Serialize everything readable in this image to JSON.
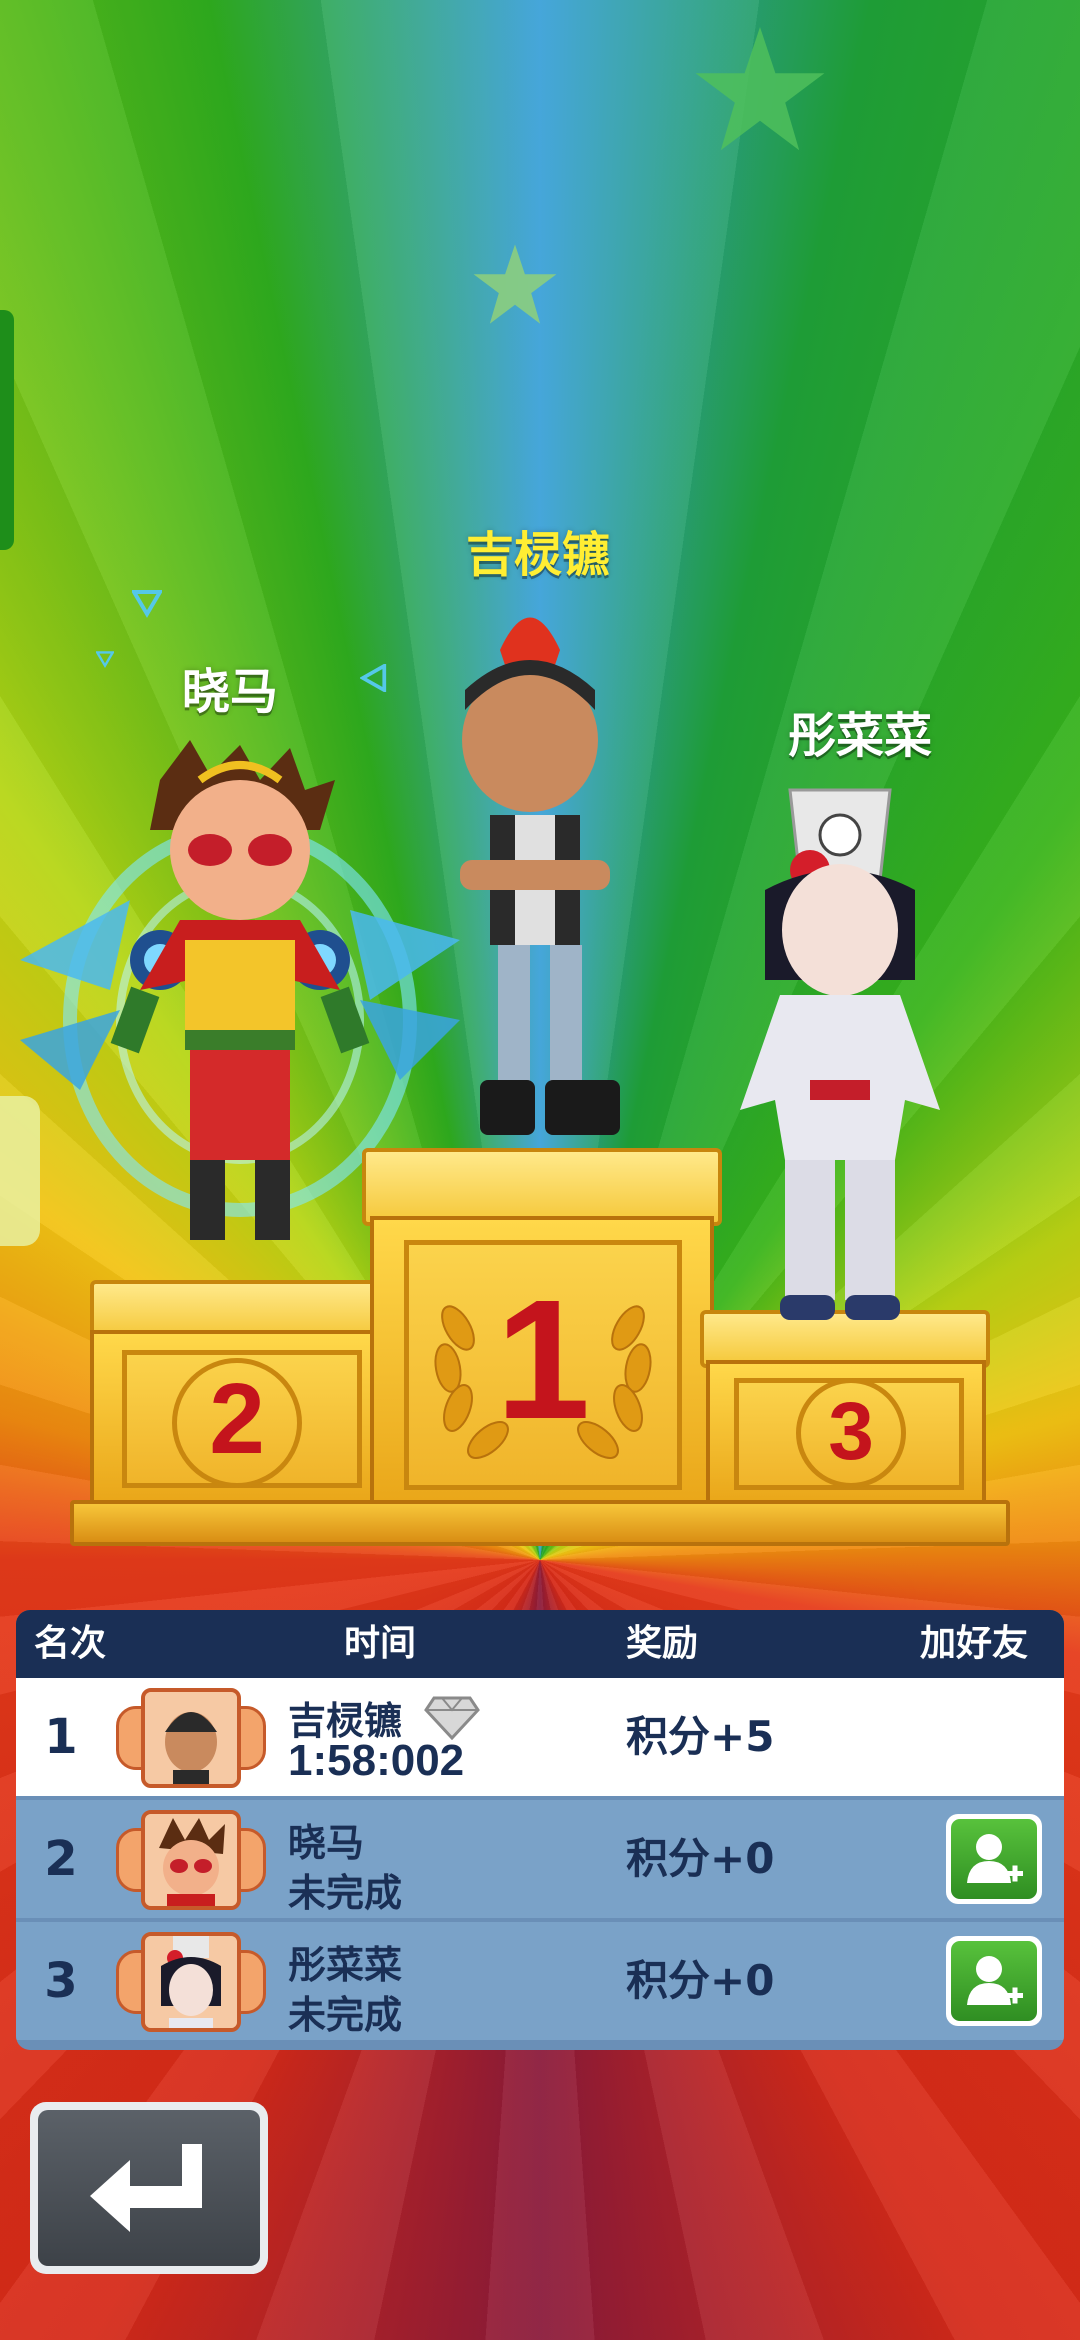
{
  "podium": {
    "first_name": "吉棂镳",
    "second_name": "晓马",
    "third_name": "彤菜菜",
    "first_num": "1",
    "second_num": "2",
    "third_num": "3"
  },
  "table": {
    "headers": {
      "rank": "名次",
      "time": "时间",
      "reward": "奖励",
      "add_friend": "加好友"
    },
    "rows": [
      {
        "rank": "1",
        "name": "吉棂镳",
        "detail": "1:58:002",
        "reward": "积分+5",
        "can_add_friend": false
      },
      {
        "rank": "2",
        "name": "晓马",
        "detail": "未完成",
        "reward": "积分+0",
        "can_add_friend": true
      },
      {
        "rank": "3",
        "name": "彤菜菜",
        "detail": "未完成",
        "reward": "积分+0",
        "can_add_friend": true
      }
    ]
  },
  "icons": {
    "diamond": "diamond-icon",
    "add_friend": "add-friend-icon",
    "back": "return-arrow-icon"
  },
  "colors": {
    "table_header": "#1a2f55",
    "highlight_row": "#ffffff",
    "other_rows": "#7aa2c8",
    "friend_button": "#3fa82c",
    "first_name": "#ffee33"
  }
}
